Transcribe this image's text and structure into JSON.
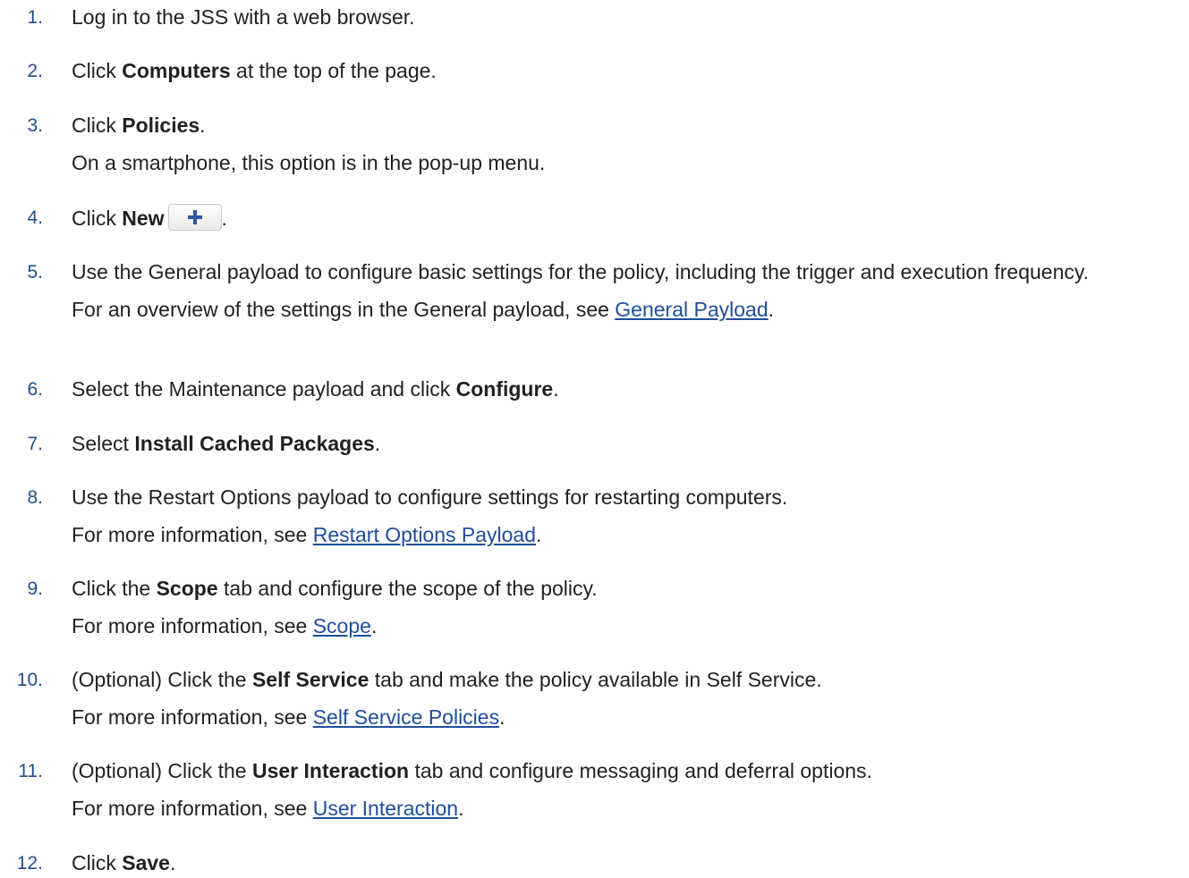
{
  "steps": [
    {
      "num": "1.",
      "lines": [
        [
          "Log in to the JSS with a web browser."
        ]
      ]
    },
    {
      "num": "2.",
      "lines": [
        [
          "Click ",
          {
            "b": "Computers"
          },
          " at the top of the page."
        ]
      ]
    },
    {
      "num": "3.",
      "lines": [
        [
          "Click ",
          {
            "b": "Policies"
          },
          "."
        ],
        [
          "On a smartphone, this option is in the pop-up menu."
        ]
      ]
    },
    {
      "num": "4.",
      "lines": [
        [
          "Click ",
          {
            "b": "New"
          },
          {
            "icon": "plus-icon"
          },
          "."
        ]
      ]
    },
    {
      "num": "5.",
      "lines": [
        [
          "Use the General payload to configure basic settings for the policy, including the trigger and execution frequency."
        ],
        [
          "For an overview of the settings in the General payload, see ",
          {
            "link": "General Payload"
          },
          "."
        ]
      ]
    },
    {
      "num": "6.",
      "lines": [
        [
          "Select the Maintenance payload and click ",
          {
            "b": "Configure"
          },
          "."
        ]
      ]
    },
    {
      "num": "7.",
      "lines": [
        [
          "Select ",
          {
            "b": "Install Cached Packages"
          },
          "."
        ]
      ]
    },
    {
      "num": "8.",
      "lines": [
        [
          "Use the Restart Options payload to configure settings for restarting computers."
        ],
        [
          "For more information, see ",
          {
            "link": "Restart Options Payload"
          },
          "."
        ]
      ]
    },
    {
      "num": "9.",
      "lines": [
        [
          "Click the ",
          {
            "b": "Scope"
          },
          " tab and configure the scope of the policy."
        ],
        [
          "For more information, see ",
          {
            "link": "Scope"
          },
          "."
        ]
      ]
    },
    {
      "num": "10.",
      "lines": [
        [
          "(Optional) Click the ",
          {
            "b": "Self Service"
          },
          " tab and make the policy available in Self Service."
        ],
        [
          "For more information, see ",
          {
            "link": "Self Service Policies"
          },
          "."
        ]
      ]
    },
    {
      "num": "11.",
      "lines": [
        [
          "(Optional) Click the ",
          {
            "b": "User Interaction"
          },
          " tab and configure messaging and deferral options."
        ],
        [
          "For more information, see ",
          {
            "link": "User Interaction"
          },
          "."
        ]
      ]
    },
    {
      "num": "12.",
      "lines": [
        [
          "Click ",
          {
            "b": "Save"
          },
          "."
        ]
      ]
    }
  ],
  "colors": {
    "step_number": "#1f4e87",
    "link": "#1f4e9c",
    "plus_icon": "#2b5aa8",
    "text": "#231f20"
  }
}
